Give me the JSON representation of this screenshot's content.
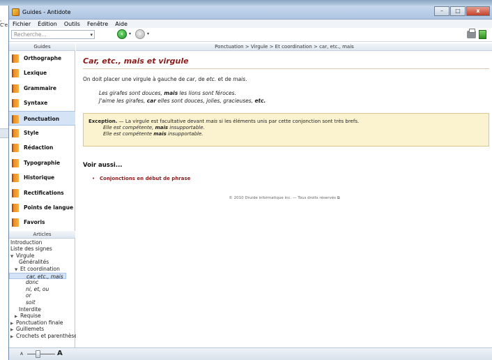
{
  "background": {
    "left_text": ", C'e"
  },
  "window": {
    "title": "Guides - Antidote",
    "buttons": {
      "minimize": "–",
      "maximize": "□",
      "close": "x"
    }
  },
  "menu": [
    "Fichier",
    "Édition",
    "Outils",
    "Fenêtre",
    "Aide"
  ],
  "toolbar": {
    "search_placeholder": "Recherche...",
    "dropdown_arrow": "▾"
  },
  "sidebar": {
    "guides_header": "Guides",
    "guides": [
      {
        "label": "Orthographe",
        "selected": false
      },
      {
        "label": "Lexique",
        "selected": false
      },
      {
        "label": "Grammaire",
        "selected": false
      },
      {
        "label": "Syntaxe",
        "selected": false
      },
      {
        "label": "Ponctuation",
        "selected": true
      },
      {
        "label": "Style",
        "selected": false
      },
      {
        "label": "Rédaction",
        "selected": false
      },
      {
        "label": "Typographie",
        "selected": false
      },
      {
        "label": "Historique",
        "selected": false
      },
      {
        "label": "Rectifications",
        "selected": false
      },
      {
        "label": "Points de langue",
        "selected": false
      },
      {
        "label": "Favoris",
        "selected": false
      }
    ],
    "articles_header": "Articles",
    "articles": [
      {
        "label": "Introduction",
        "level": 0,
        "arrow": "",
        "italic": false,
        "selected": false
      },
      {
        "label": "Liste des signes",
        "level": 0,
        "arrow": "",
        "italic": false,
        "selected": false
      },
      {
        "label": "Virgule",
        "level": 0,
        "arrow": "▼",
        "italic": false,
        "selected": false
      },
      {
        "label": "Généralités",
        "level": 2,
        "arrow": "",
        "italic": false,
        "selected": false
      },
      {
        "label": "Et coordination",
        "level": 1,
        "arrow": "▼",
        "italic": false,
        "selected": false
      },
      {
        "label": "car, etc., mais",
        "level": 3,
        "arrow": "",
        "italic": true,
        "selected": true
      },
      {
        "label": "donc",
        "level": 3,
        "arrow": "",
        "italic": true,
        "selected": false
      },
      {
        "label": "ni, et, ou",
        "level": 3,
        "arrow": "",
        "italic": true,
        "selected": false
      },
      {
        "label": "or",
        "level": 3,
        "arrow": "",
        "italic": true,
        "selected": false
      },
      {
        "label": "soit",
        "level": 3,
        "arrow": "",
        "italic": true,
        "selected": false
      },
      {
        "label": "Interdite",
        "level": 2,
        "arrow": "",
        "italic": false,
        "selected": false
      },
      {
        "label": "Requise",
        "level": 1,
        "arrow": "▶",
        "italic": false,
        "selected": false
      },
      {
        "label": "Ponctuation finale",
        "level": 0,
        "arrow": "▶",
        "italic": false,
        "selected": false
      },
      {
        "label": "Guillemets",
        "level": 0,
        "arrow": "▶",
        "italic": false,
        "selected": false
      },
      {
        "label": "Crochets et parenthèses",
        "level": 0,
        "arrow": "▶",
        "italic": false,
        "selected": false
      }
    ]
  },
  "main": {
    "breadcrumb": "Ponctuation > Virgule > Et coordination > car, etc., mais",
    "title": "Car, etc., mais et virgule",
    "intro": {
      "t1": "On doit placer une virgule à gauche de ",
      "i1": "car",
      "t2": ", de ",
      "i2": "etc.",
      "t3": " et de ",
      "i3": "mais",
      "t4": "."
    },
    "example1": {
      "a": "Les girafes sont douces, ",
      "kw": "mais",
      "b": " les lions sont féroces."
    },
    "example2": {
      "a": "J'aime les girafes, ",
      "kw1": "car",
      "b": " elles sont douces, jolies, gracieuses, ",
      "kw2": "etc."
    },
    "exception": {
      "label": "Exception.",
      "text_a": " — La virgule est facultative devant ",
      "text_i": "mais",
      "text_b": " si les éléments unis par cette conjonction sont très brefs.",
      "ex1_a": "Elle est compétente, ",
      "ex1_kw": "mais",
      "ex1_b": " insupportable.",
      "ex2_a": "Elle est compétente ",
      "ex2_kw": "mais",
      "ex2_b": " insupportable."
    },
    "see_also": {
      "title": "Voir aussi...",
      "bullet": "•",
      "links": [
        "Conjonctions en début de phrase"
      ]
    },
    "footer": "© 2010 Druide informatique inc. — Tous droits réservés"
  },
  "statusbar": {
    "zoom_small": "A",
    "zoom_large": "A"
  },
  "colors": {
    "accent": "#8b1a1a",
    "selection": "#d4e4f6",
    "exception_bg": "#fbf3d0"
  }
}
